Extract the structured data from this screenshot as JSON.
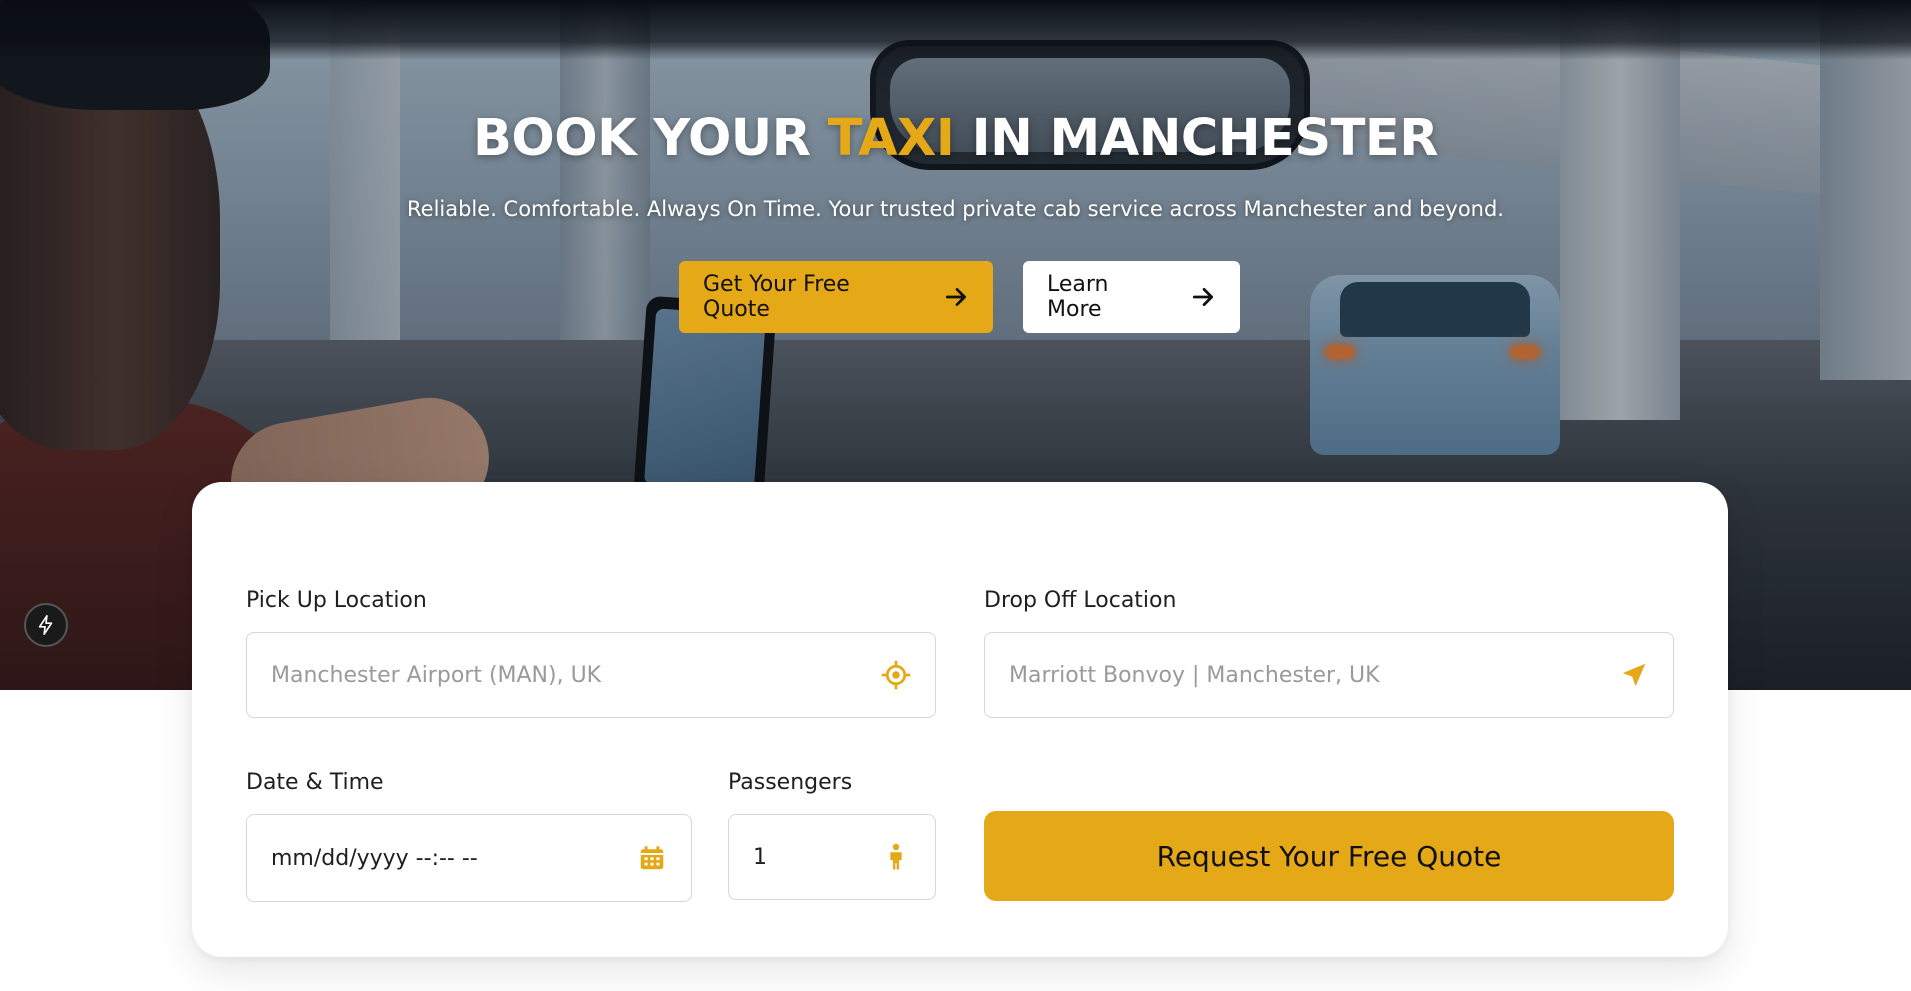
{
  "hero": {
    "title_part1": "BOOK YOUR ",
    "title_accent": "TAXI",
    "title_part2": " IN MANCHESTER",
    "subtitle": "Reliable. Comfortable. Always On Time. Your trusted private cab service across Manchester and beyond.",
    "primary_button": "Get Your Free Quote",
    "secondary_button": "Learn More"
  },
  "booking": {
    "pickup": {
      "label": "Pick Up Location",
      "placeholder": "Manchester Airport (MAN), UK",
      "icon": "crosshair-icon"
    },
    "dropoff": {
      "label": "Drop Off Location",
      "placeholder": "Marriott Bonvoy | Manchester, UK",
      "icon": "location-arrow-icon"
    },
    "datetime": {
      "label": "Date & Time",
      "value": "mm/dd/yyyy --:-- --",
      "icon": "calendar-icon"
    },
    "passengers": {
      "label": "Passengers",
      "value": "1",
      "icon": "person-icon"
    },
    "submit": "Request Your Free Quote"
  },
  "badge": {
    "icon": "bolt-icon"
  },
  "colors": {
    "accent": "#e5a817",
    "text": "#1f1f1f",
    "placeholder": "#9a9a9a",
    "border": "#d7d7d7"
  }
}
